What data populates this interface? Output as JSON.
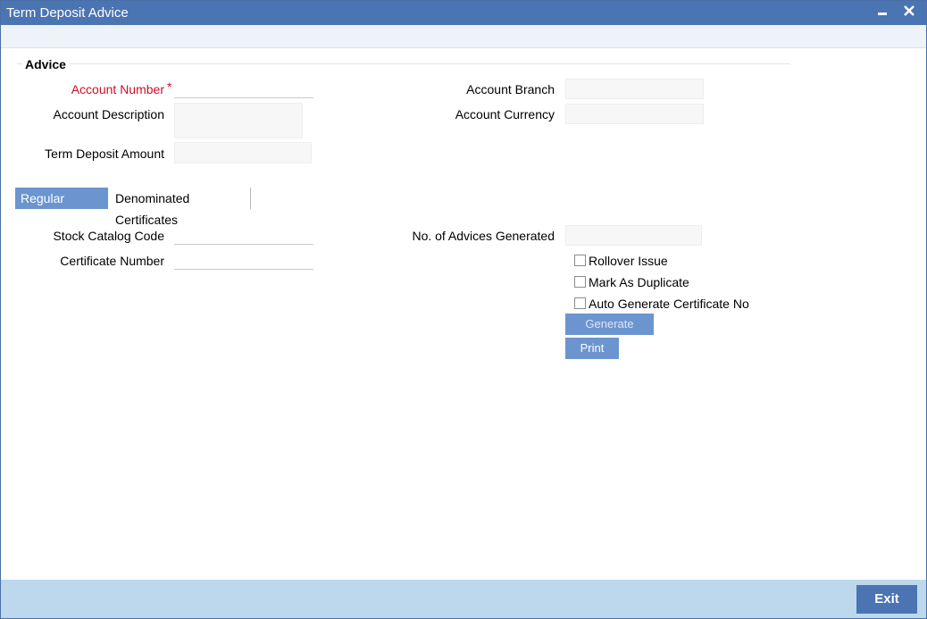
{
  "window": {
    "title": "Term Deposit Advice",
    "minimize_icon": "minimize-icon",
    "close_icon": "close-icon"
  },
  "advice": {
    "section_title": "Advice",
    "account_number_label": "Account Number",
    "account_number_required_mark": "*",
    "account_number_value": "",
    "account_description_label": "Account Description",
    "account_description_value": "",
    "term_deposit_amount_label": "Term Deposit Amount",
    "term_deposit_amount_value": "",
    "account_branch_label": "Account Branch",
    "account_branch_value": "",
    "account_currency_label": "Account Currency",
    "account_currency_value": ""
  },
  "tabs": [
    {
      "label": "Regular Deposit",
      "active": true
    },
    {
      "label": "Denominated Certificates",
      "active": false
    }
  ],
  "regular_deposit": {
    "stock_catalog_code_label": "Stock Catalog Code",
    "stock_catalog_code_value": "",
    "certificate_number_label": "Certificate Number",
    "certificate_number_value": "",
    "advices_generated_label": "No. of Advices Generated",
    "advices_generated_value": "",
    "checkboxes": [
      {
        "label": "Rollover Issue",
        "checked": false
      },
      {
        "label": "Mark As Duplicate",
        "checked": false
      },
      {
        "label": "Auto Generate Certificate No",
        "checked": false
      }
    ],
    "generate_label": "Generate",
    "print_label": "Print"
  },
  "footer": {
    "exit_label": "Exit"
  },
  "colors": {
    "titlebar": "#4b74b3",
    "tab_active": "#6c95cf",
    "required": "#c8102e",
    "footer": "#bdd8ed"
  }
}
